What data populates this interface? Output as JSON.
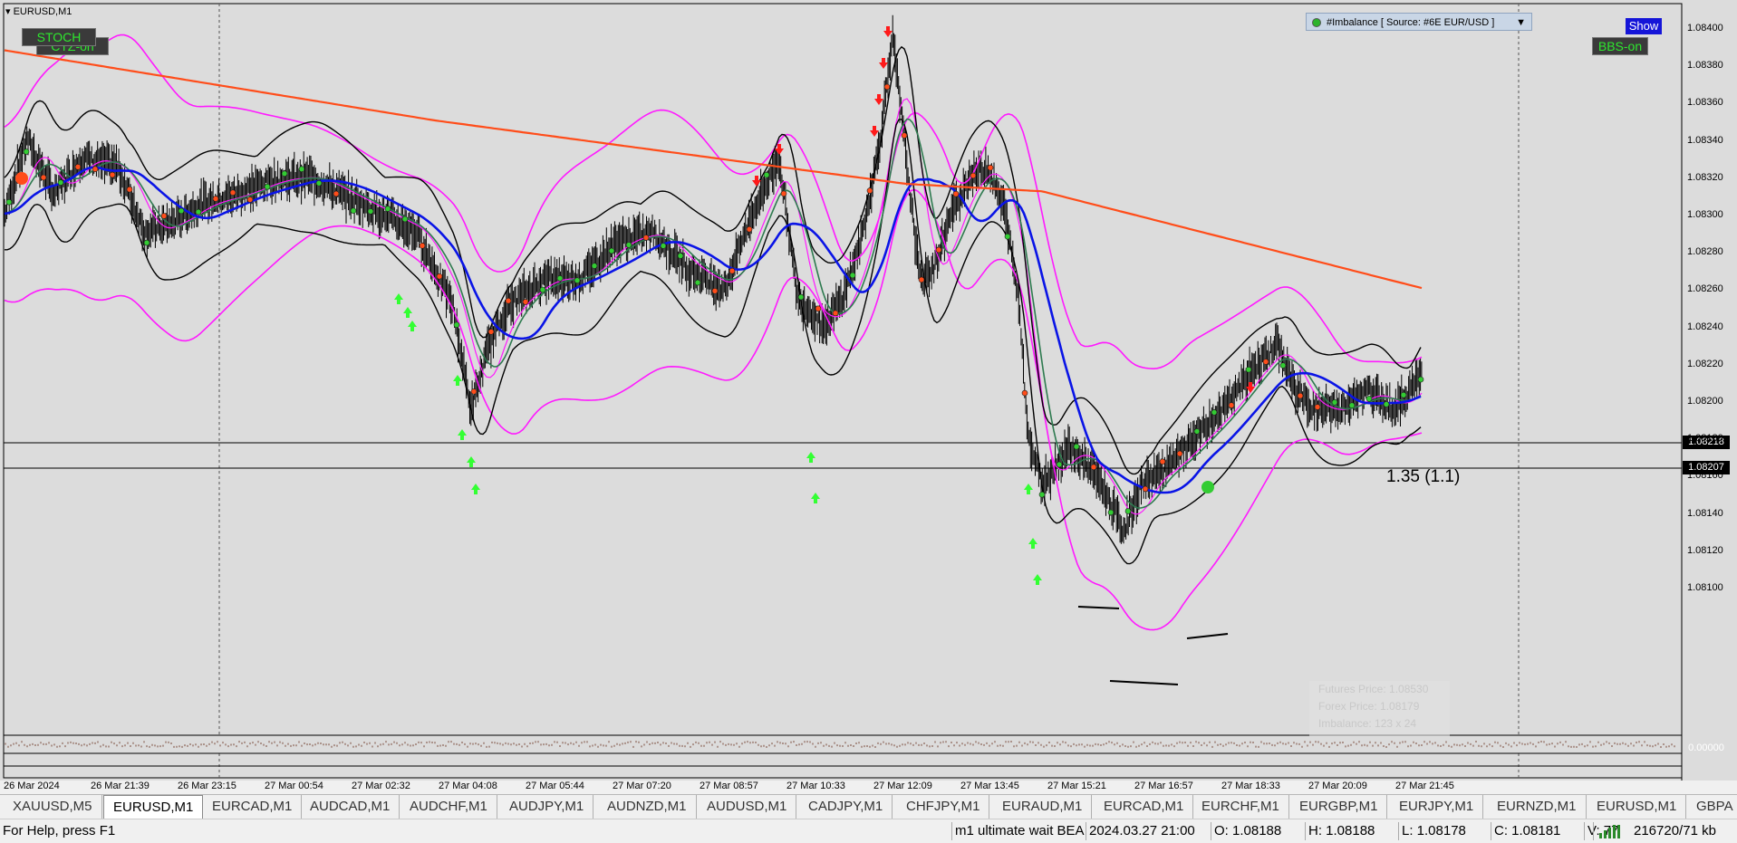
{
  "chart": {
    "symbol_label": "EURUSD,M1",
    "price_labels": [
      "1.08400",
      "1.08380",
      "1.08360",
      "1.08340",
      "1.08320",
      "1.08300",
      "1.08280",
      "1.08260",
      "1.08240",
      "1.08220",
      "1.08200",
      "1.08180",
      "1.08160",
      "1.08140",
      "1.08120",
      "1.08100"
    ],
    "time_labels": [
      "26 Mar 2024",
      "26 Mar 21:39",
      "26 Mar 23:15",
      "27 Mar 00:54",
      "27 Mar 02:32",
      "27 Mar 04:08",
      "27 Mar 05:44",
      "27 Mar 07:20",
      "27 Mar 08:57",
      "27 Mar 10:33",
      "27 Mar 12:09",
      "27 Mar 13:45",
      "27 Mar 15:21",
      "27 Mar 16:57",
      "27 Mar 18:33",
      "27 Mar 20:09",
      "27 Mar 21:45"
    ],
    "hline_price_1": "1.08218",
    "hline_price_2": "1.08207",
    "sub_window_value": "0.00000",
    "ratio_label": "1.35 (1.1)",
    "colors": {
      "background": "#dcdcdc",
      "bollinger": "#ff1aff",
      "ma_blue": "#0a14e6",
      "ma_orange": "#ff4d1a",
      "ma_green": "#2e7a4f",
      "price": "#000000",
      "arrow_up": "#33ff33",
      "arrow_down": "#ff1a1a"
    }
  },
  "overlay": {
    "stoch_label": "STOCH",
    "ctz_label": "CTZ-on",
    "bbs_label": "BBS-on",
    "show_label": "Show",
    "imbalance_dropdown": "#Imbalance [ Source: #6E EUR/USD ]",
    "futures_price": "Futures Price: 1.08530",
    "forex_price": "Forex Price: 1.08179",
    "imbalance": "Imbalance: 123 x 24"
  },
  "tabs": [
    "XAUUSD,M5",
    "EURUSD,M1",
    "EURCAD,M1",
    "AUDCAD,M1",
    "AUDCHF,M1",
    "AUDJPY,M1",
    "AUDNZD,M1",
    "AUDUSD,M1",
    "CADJPY,M1",
    "CHFJPY,M1",
    "EURAUD,M1",
    "EURCAD,M1",
    "EURCHF,M1",
    "EURGBP,M1",
    "EURJPY,M1",
    "EURNZD,M1",
    "EURUSD,M1",
    "GBPA"
  ],
  "active_tab_index": 1,
  "status": {
    "help": "For Help, press F1",
    "profile": "m1 ultimate wait BEA",
    "datetime": "2024.03.27 21:00",
    "open": "O: 1.08188",
    "high": "H: 1.08188",
    "low": "L: 1.08178",
    "close": "C: 1.08181",
    "volume": "V: 77",
    "traffic": "216720/71 kb"
  }
}
